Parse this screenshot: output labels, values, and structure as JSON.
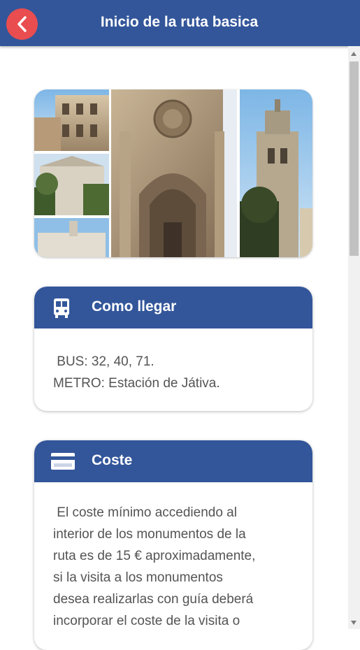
{
  "header": {
    "title": "Inicio de la ruta basica"
  },
  "cards": {
    "how_to_get": {
      "title": "Como llegar",
      "line1": " BUS: 32, 40, 71.",
      "line2": "METRO: Estación de Játiva."
    },
    "cost": {
      "title": "Coste",
      "lines": [
        " El coste mínimo accediendo al",
        "interior de los monumentos de la",
        "ruta es de 15 € aproximadamente,",
        "si la visita a los monumentos",
        "desea realizarlas con guía deberá",
        "incorporar el coste de la visita o"
      ]
    }
  },
  "icons": {
    "back": "chevron-left-icon",
    "transport": "bus-icon",
    "cost": "credit-card-icon"
  },
  "colors": {
    "primary": "#33569a",
    "back_button": "#e94d4f",
    "body_text": "#545454"
  }
}
